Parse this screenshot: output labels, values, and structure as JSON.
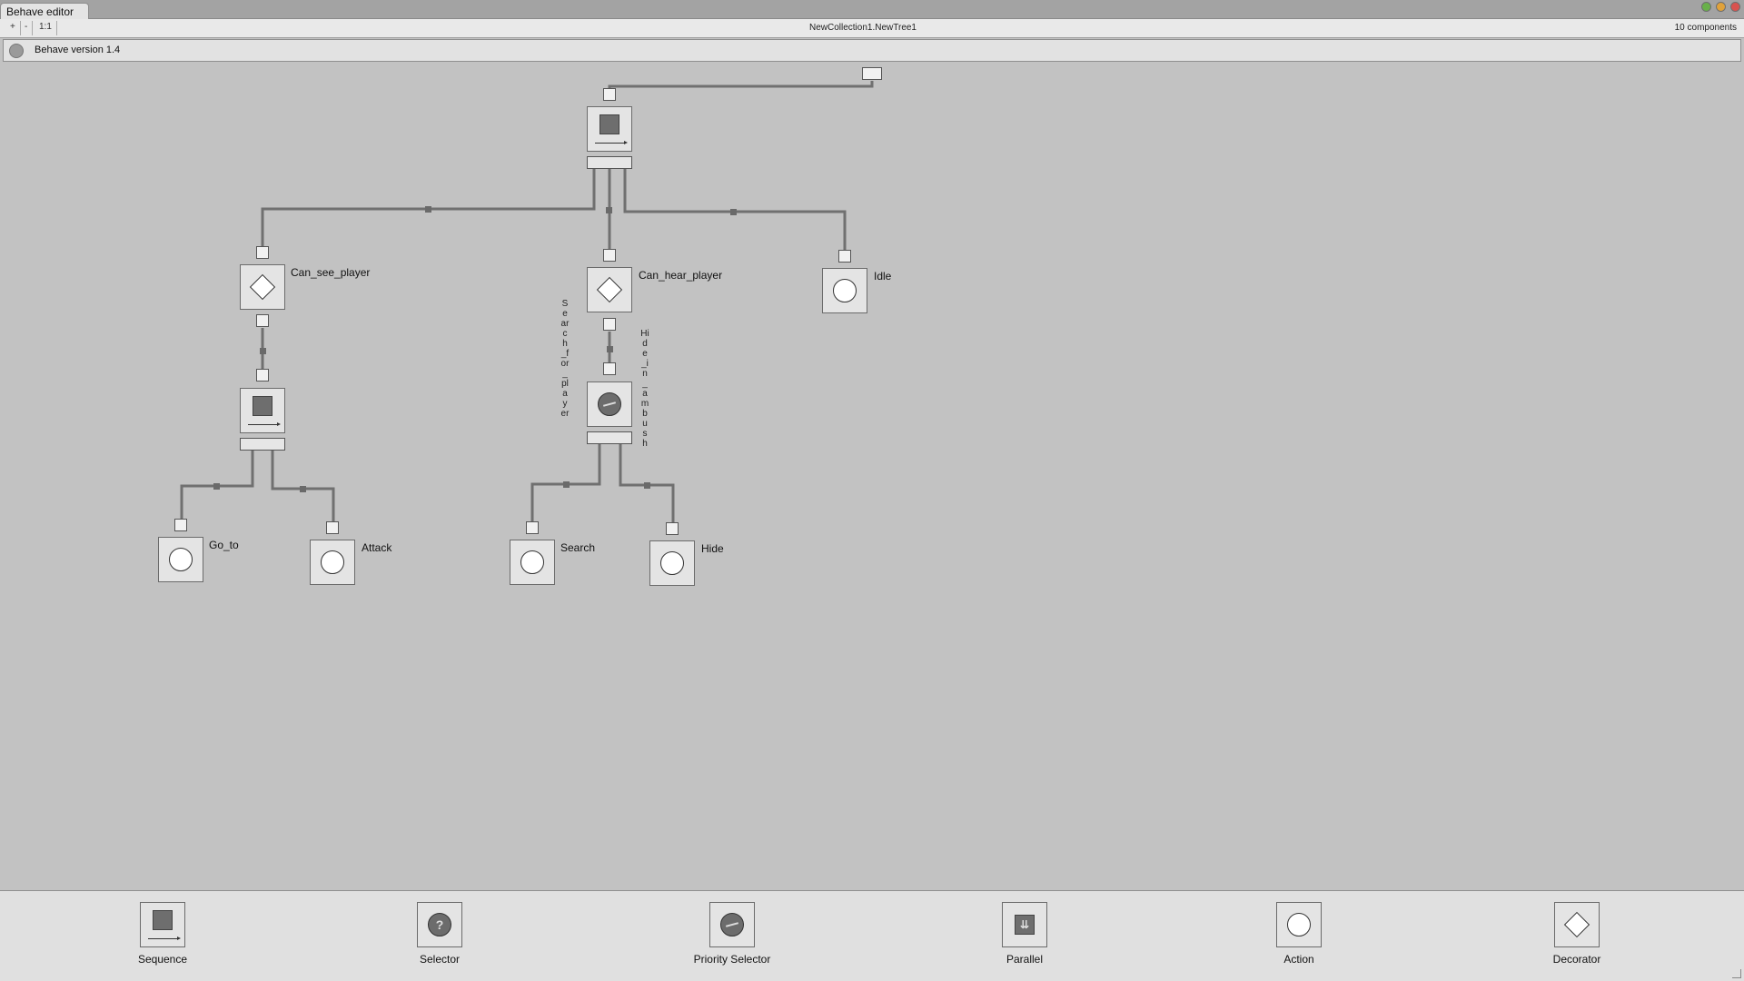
{
  "window": {
    "tab_label": "Behave editor",
    "zoom_in": "+",
    "zoom_out": "-",
    "zoom_reset": "1:1",
    "tree_title": "NewCollection1.NewTree1",
    "component_count": "10 components",
    "version": "Behave version 1.4"
  },
  "tree": {
    "nodes": {
      "can_see_player": "Can_see_player",
      "can_hear_player": "Can_hear_player",
      "idle": "Idle",
      "go_to": "Go_to",
      "attack": "Attack",
      "search": "Search",
      "hide": "Hide"
    },
    "branch_labels": {
      "search_for_player": "Search_for_player",
      "hide_in_ambush": "Hide_in_ambush"
    }
  },
  "palette": {
    "items": [
      {
        "label": "Sequence",
        "icon": "sequence-icon"
      },
      {
        "label": "Selector",
        "icon": "selector-icon"
      },
      {
        "label": "Priority Selector",
        "icon": "priority-selector-icon"
      },
      {
        "label": "Parallel",
        "icon": "parallel-icon"
      },
      {
        "label": "Action",
        "icon": "action-icon"
      },
      {
        "label": "Decorator",
        "icon": "decorator-icon"
      }
    ]
  },
  "colors": {
    "canvas": "#c2c2c2",
    "node_fill": "#e4e4e4",
    "connector": "#707070"
  }
}
